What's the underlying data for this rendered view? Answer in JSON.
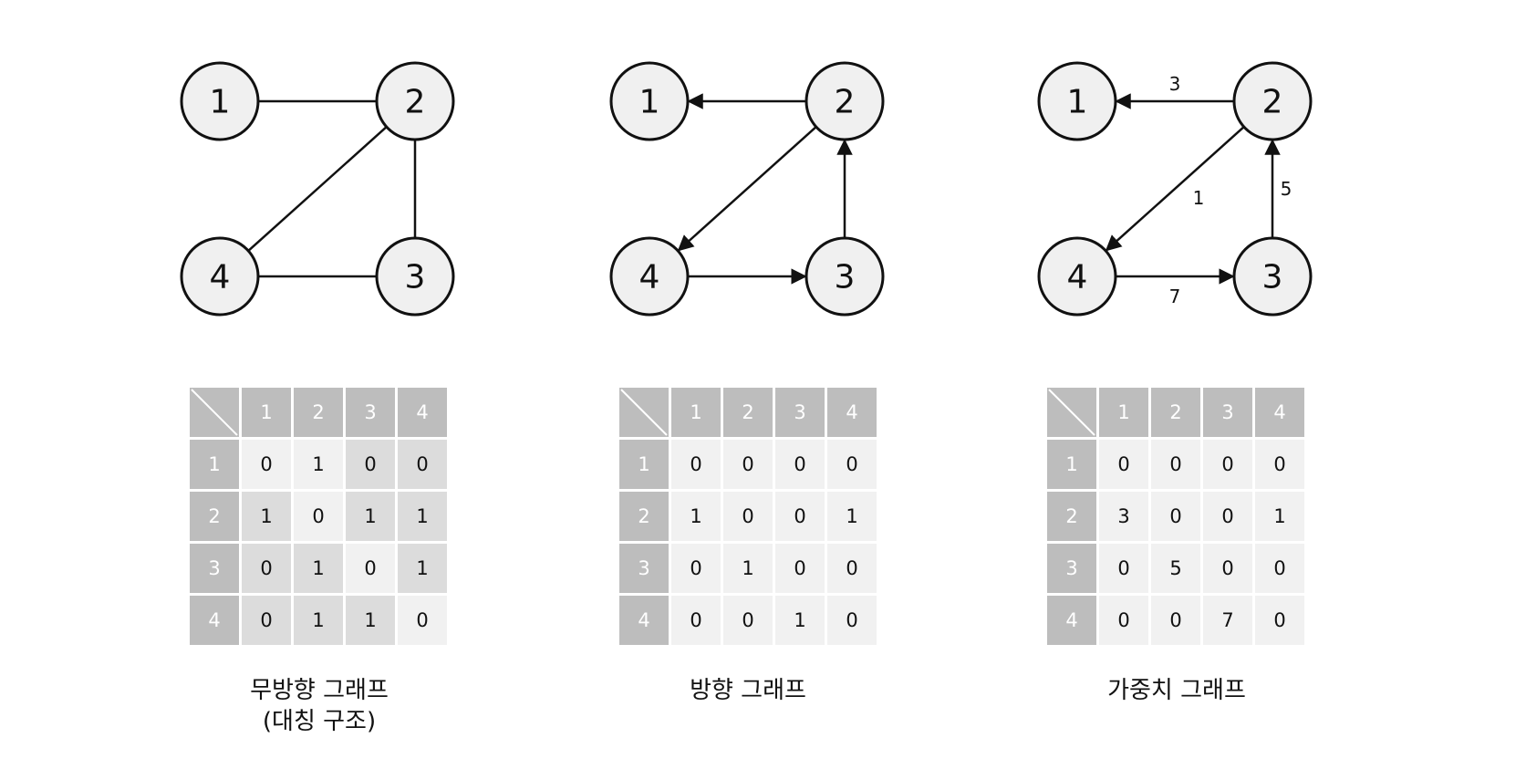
{
  "panels": [
    {
      "id": "undirected",
      "caption_line1": "무방향 그래프",
      "caption_line2": "(대칭 구조)",
      "directed": false,
      "weighted": false,
      "nodes": [
        "1",
        "2",
        "3",
        "4"
      ],
      "edges": [
        {
          "from": "1",
          "to": "2"
        },
        {
          "from": "2",
          "to": "4"
        },
        {
          "from": "2",
          "to": "3"
        },
        {
          "from": "4",
          "to": "3"
        }
      ],
      "matrix": {
        "headers": [
          "1",
          "2",
          "3",
          "4"
        ],
        "rows": [
          [
            "0",
            "1",
            "0",
            "0"
          ],
          [
            "1",
            "0",
            "1",
            "1"
          ],
          [
            "0",
            "1",
            "0",
            "1"
          ],
          [
            "0",
            "1",
            "1",
            "0"
          ]
        ]
      }
    },
    {
      "id": "directed",
      "caption_line1": "방향 그래프",
      "caption_line2": "",
      "directed": true,
      "weighted": false,
      "nodes": [
        "1",
        "2",
        "3",
        "4"
      ],
      "edges": [
        {
          "from": "2",
          "to": "1"
        },
        {
          "from": "2",
          "to": "4"
        },
        {
          "from": "3",
          "to": "2"
        },
        {
          "from": "4",
          "to": "3"
        }
      ],
      "matrix": {
        "headers": [
          "1",
          "2",
          "3",
          "4"
        ],
        "rows": [
          [
            "0",
            "0",
            "0",
            "0"
          ],
          [
            "1",
            "0",
            "0",
            "1"
          ],
          [
            "0",
            "1",
            "0",
            "0"
          ],
          [
            "0",
            "0",
            "1",
            "0"
          ]
        ]
      }
    },
    {
      "id": "weighted",
      "caption_line1": "가중치 그래프",
      "caption_line2": "",
      "directed": true,
      "weighted": true,
      "nodes": [
        "1",
        "2",
        "3",
        "4"
      ],
      "edges": [
        {
          "from": "2",
          "to": "1",
          "weight": "3"
        },
        {
          "from": "2",
          "to": "4",
          "weight": "1"
        },
        {
          "from": "3",
          "to": "2",
          "weight": "5"
        },
        {
          "from": "4",
          "to": "3",
          "weight": "7"
        }
      ],
      "matrix": {
        "headers": [
          "1",
          "2",
          "3",
          "4"
        ],
        "rows": [
          [
            "0",
            "0",
            "0",
            "0"
          ],
          [
            "3",
            "0",
            "0",
            "1"
          ],
          [
            "0",
            "5",
            "0",
            "0"
          ],
          [
            "0",
            "0",
            "7",
            "0"
          ]
        ]
      }
    }
  ],
  "colors": {
    "node_fill": "#f0f0f0",
    "stroke": "#111111",
    "header_fill": "#bdbdbd",
    "cell_fill": "#f1f1f1",
    "cell_fill_shaded": "#dcdcdc"
  }
}
